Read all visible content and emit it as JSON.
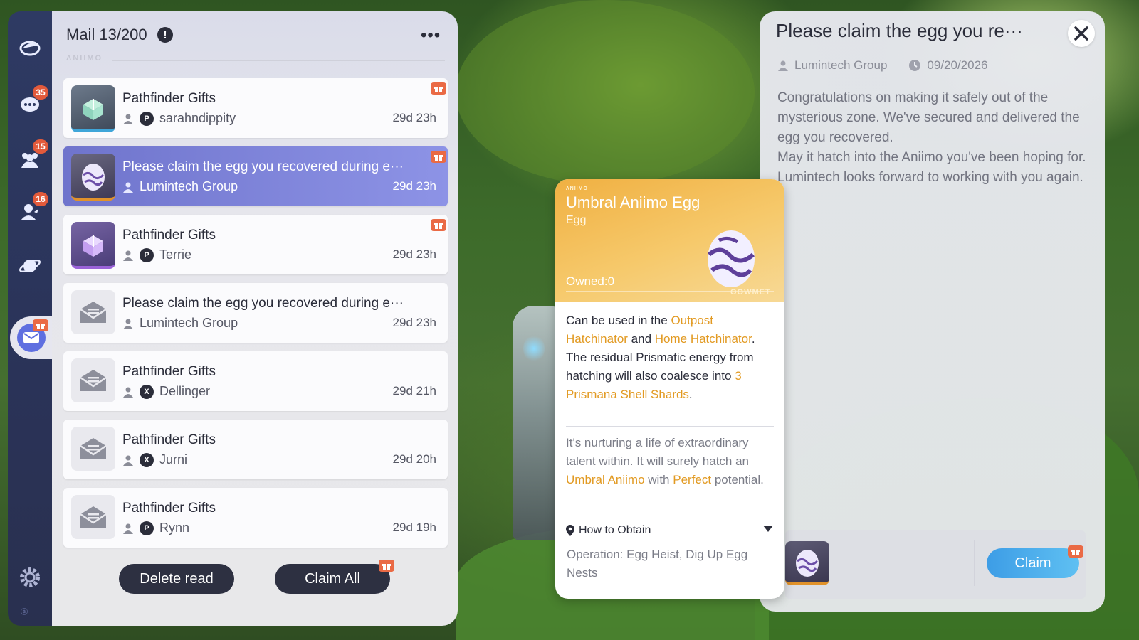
{
  "nav": {
    "items": [
      {
        "name": "home",
        "icon": "home-icon"
      },
      {
        "name": "chat",
        "icon": "chat-icon",
        "badge": "35"
      },
      {
        "name": "friends",
        "icon": "friends-icon",
        "badge": "15"
      },
      {
        "name": "social",
        "icon": "social-icon",
        "badge": "16"
      },
      {
        "name": "planet",
        "icon": "planet-icon"
      },
      {
        "name": "mail",
        "icon": "mail-icon",
        "active": true
      },
      {
        "name": "settings",
        "icon": "gear-icon"
      }
    ]
  },
  "mail": {
    "title": "Mail",
    "count": "13/200",
    "more_label": "•••",
    "items": [
      {
        "subject": "Pathfinder Gifts",
        "sender": "sarahndippity",
        "time": "29d 23h",
        "thumb": "gift-box-teal"
      },
      {
        "subject": "Please claim the egg you recovered during e···",
        "sender": "Lumintech Group",
        "time": "29d 23h",
        "thumb": "egg",
        "selected": true
      },
      {
        "subject": "Pathfinder Gifts",
        "sender": "Terrie",
        "time": "29d 23h",
        "thumb": "gift-box-purple"
      },
      {
        "subject": "Please claim the egg you recovered during e···",
        "sender": "Lumintech Group",
        "time": "29d 23h",
        "thumb": "envelope"
      },
      {
        "subject": "Pathfinder Gifts",
        "sender": "Dellinger",
        "time": "29d 21h",
        "thumb": "envelope"
      },
      {
        "subject": "Pathfinder Gifts",
        "sender": "Jurni",
        "time": "29d 20h",
        "thumb": "envelope"
      },
      {
        "subject": "Pathfinder Gifts",
        "sender": "Rynn",
        "time": "29d 19h",
        "thumb": "envelope"
      }
    ],
    "delete_label": "Delete read",
    "claim_all_label": "Claim All"
  },
  "item": {
    "name": "Umbral Aniimo Egg",
    "type": "Egg",
    "owned_label": "Owned:",
    "owned_value": "0",
    "logo": "OOWMET",
    "desc": {
      "t1": "Can be used in the ",
      "h1": "Outpost Hatchinator",
      "t2": " and ",
      "h2": "Home Hatchinator",
      "t3": ". The residual Prismatic energy from hatching will also coalesce into ",
      "h3": "3 Prismana Shell Shards",
      "t4": "."
    },
    "flavor": {
      "t1": "It's nurturing a life of extraordinary talent within. It will surely hatch an ",
      "h1": "Umbral Aniimo",
      "t2": " with ",
      "h2": "Perfect",
      "t3": " potential."
    },
    "how_to_obtain_label": "How to Obtain",
    "obtain_details": "Operation: Egg Heist, Dig Up Egg Nests"
  },
  "detail": {
    "title": "Please claim the egg you re···",
    "sender": "Lumintech Group",
    "date": "09/20/2026",
    "body_p1": "Congratulations on making it safely out of the mysterious zone. We've secured and delivered the egg you recovered.",
    "body_p2": "May it hatch into the Aniimo you've been hoping for. Lumintech looks forward to working with you again.",
    "claim_label": "Claim"
  },
  "colors": {
    "highlight": "#e29a22",
    "selected_mail": "#7b80d8",
    "badge": "#e25a3b",
    "claim_button": "#4aaeee",
    "item_header": "#f3bd55"
  }
}
